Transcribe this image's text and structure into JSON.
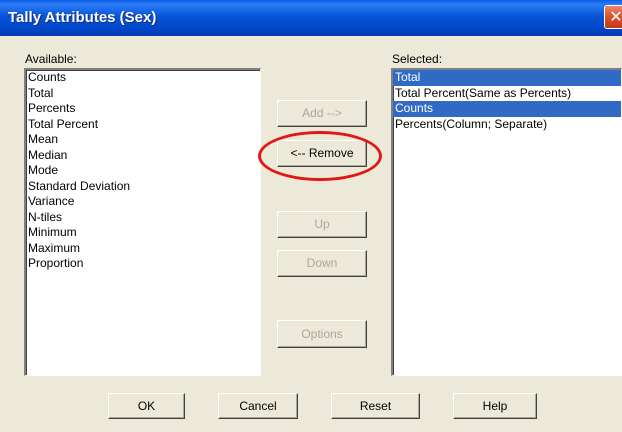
{
  "window": {
    "title": "Tally Attributes (Sex)",
    "close_symbol": "✕"
  },
  "available": {
    "label": "Available:",
    "items": [
      "Counts",
      "Total",
      "Percents",
      "Total Percent",
      "Mean",
      "Median",
      "Mode",
      "Standard Deviation",
      "Variance",
      "N-tiles",
      "Minimum",
      "Maximum",
      "Proportion"
    ]
  },
  "selected": {
    "label": "Selected:",
    "items": [
      "Total",
      "Total Percent(Same as Percents)",
      "Counts",
      "Percents(Column; Separate)"
    ],
    "highlighted": [
      "Total",
      "Counts"
    ]
  },
  "buttons": {
    "add": "Add -->",
    "remove": "<-- Remove",
    "up": "Up",
    "down": "Down",
    "options": "Options",
    "ok": "OK",
    "cancel": "Cancel",
    "reset": "Reset",
    "help": "Help"
  },
  "colors": {
    "selection": "#316ac5",
    "annotation": "#e01818"
  }
}
